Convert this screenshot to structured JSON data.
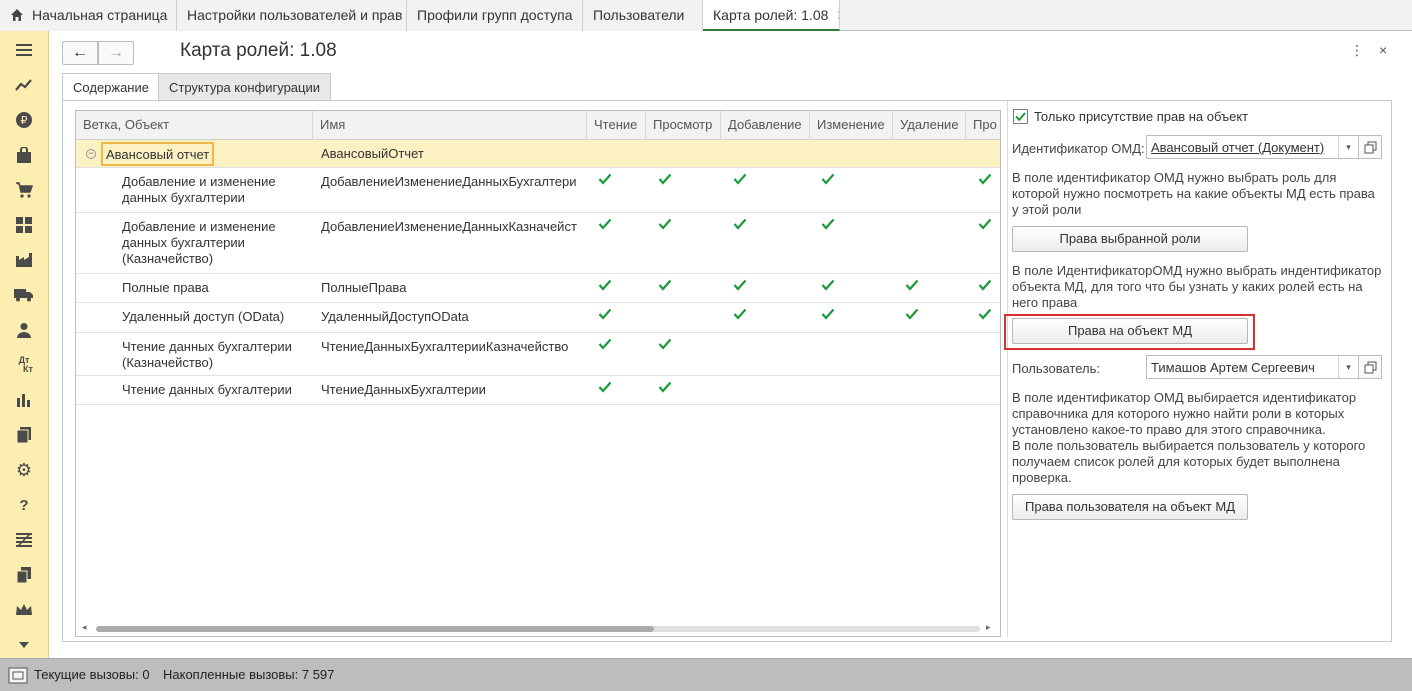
{
  "tabs": [
    {
      "label": "Начальная страница",
      "active": false,
      "home": true
    },
    {
      "label": "Настройки пользователей и прав",
      "active": false,
      "closable": true
    },
    {
      "label": "Профили групп доступа",
      "active": false,
      "closable": true
    },
    {
      "label": "Пользователи",
      "active": false,
      "closable": false
    },
    {
      "label": "Карта ролей: 1.08",
      "active": true,
      "closable": true
    }
  ],
  "sidebar_icons": [
    "menu-icon",
    "chart-line-icon",
    "ruble-icon",
    "bag-icon",
    "cart-icon",
    "grid-icon",
    "factory-icon",
    "truck-icon",
    "person-icon",
    "dt-kt-icon",
    "bar-chart-icon",
    "documents-icon",
    "gear-icon",
    "question-icon",
    "list-icon",
    "copy-icon",
    "crown-icon",
    "chevron-down-icon"
  ],
  "sidebar_labels": {
    "dt_kt_top": "Дт",
    "dt_kt_bottom": "Кт",
    "question": "?"
  },
  "form": {
    "title": "Карта ролей: 1.08",
    "back_glyph": "←",
    "forward_glyph": "→",
    "more_glyph": "⋮",
    "close_glyph": "×"
  },
  "inner_tabs": [
    {
      "label": "Содержание",
      "active": true
    },
    {
      "label": "Структура конфигурации",
      "active": false
    }
  ],
  "table": {
    "columns": [
      "Ветка, Объект",
      "Имя",
      "Чтение",
      "Просмотр",
      "Добавление",
      "Изменение",
      "Удаление",
      "Про"
    ],
    "rows": [
      {
        "branch": "Авансовый отчет",
        "name": "АвансовыйОтчет",
        "selected": true,
        "rights": [
          false,
          false,
          false,
          false,
          false,
          false
        ]
      },
      {
        "branch": "Добавление и изменение данных бухгалтерии",
        "name": "ДобавлениеИзменениеДанныхБухгалтери",
        "rights": [
          true,
          true,
          true,
          true,
          false,
          true
        ]
      },
      {
        "branch": "Добавление и изменение данных бухгалтерии (Казначейство)",
        "name": "ДобавлениеИзменениеДанныхКазначейст",
        "rights": [
          true,
          true,
          true,
          true,
          false,
          true
        ]
      },
      {
        "branch": "Полные права",
        "name": "ПолныеПрава",
        "rights": [
          true,
          true,
          true,
          true,
          true,
          true
        ]
      },
      {
        "branch": "Удаленный доступ (OData)",
        "name": "УдаленныйДоступOData",
        "rights": [
          true,
          false,
          true,
          true,
          true,
          true
        ]
      },
      {
        "branch": "Чтение данных бухгалтерии (Казначейство)",
        "name": "ЧтениеДанныхБухгалтерииКазначейство",
        "rights": [
          true,
          true,
          false,
          false,
          false,
          false
        ]
      },
      {
        "branch": "Чтение данных бухгалтерии",
        "name": "ЧтениеДанныхБухгалтерии",
        "rights": [
          true,
          true,
          false,
          false,
          false,
          false
        ]
      }
    ],
    "tree_toggle_glyph": "−",
    "scroll_left_glyph": "◂",
    "scroll_right_glyph": "▸"
  },
  "right_panel": {
    "only_rights_checkbox_label": "Только присутствие прав на объект",
    "only_rights_checked": true,
    "omd_label": "Идентификатор ОМД:",
    "omd_value": "Авансовый отчет (Документ)",
    "text1": "В поле идентификатор ОМД нужно выбрать роль для которой нужно посмотреть на какие объекты МД есть права у этой роли",
    "btn_role_rights": "Права выбранной роли",
    "text2": "В поле ИдентификаторОМД нужно выбрать индентификатор объекта МД, для того что бы узнать у каких ролей есть на него права",
    "btn_object_rights": "Права на объект МД",
    "user_label": "Пользователь:",
    "user_value": "Тимашов Артем Сергеевич",
    "text3": "В поле идентификатор ОМД выбирается идентификатор справочника для которого нужно найти роли в которых установлено какое-то право для этого справочника.\nВ поле пользователь выбирается пользователь у которого получаем список ролей для которых будет выполнена проверка.",
    "btn_user_rights": "Права пользователя на объект МД",
    "dropdown_glyph": "▾"
  },
  "status_bar": {
    "current_calls": "Текущие вызовы: 0",
    "accumulated_calls": "Накопленные вызовы: 7 597"
  },
  "colors": {
    "accent_green": "#2e7d32",
    "check_green": "#1a9a3a",
    "sidebar_bg": "#fbeeb0",
    "selected_row": "#fbf1c2",
    "highlight_red": "#d9302c"
  }
}
